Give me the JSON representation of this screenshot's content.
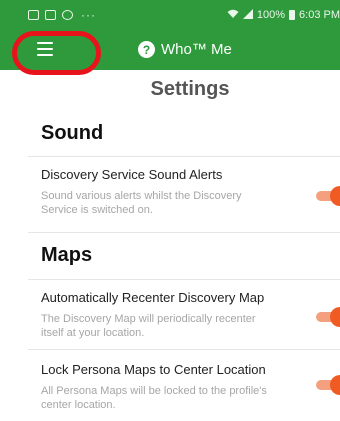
{
  "status_bar": {
    "dots": "···",
    "battery_text": "100%",
    "time": "6:03 PM"
  },
  "app_bar": {
    "title": "Who™ Me",
    "help_glyph": "?"
  },
  "page": {
    "title": "Settings"
  },
  "sections": [
    {
      "heading": "Sound",
      "items": [
        {
          "title": "Discovery Service Sound Alerts",
          "description": "Sound various alerts whilst the Discovery Service is switched on.",
          "enabled": true
        }
      ]
    },
    {
      "heading": "Maps",
      "items": [
        {
          "title": "Automatically Recenter Discovery Map",
          "description": "The Discovery Map will periodically recenter itself at your location.",
          "enabled": true
        },
        {
          "title": "Lock Persona Maps to Center Location",
          "description": "All Persona Maps will be locked to the profile's center location.",
          "enabled": true
        }
      ]
    }
  ],
  "colors": {
    "primary": "#2e9a3c",
    "accent": "#f05a23",
    "highlight": "#e8141c"
  },
  "icons": {
    "menu": "hamburger-menu-icon",
    "help": "question-circle-icon"
  }
}
